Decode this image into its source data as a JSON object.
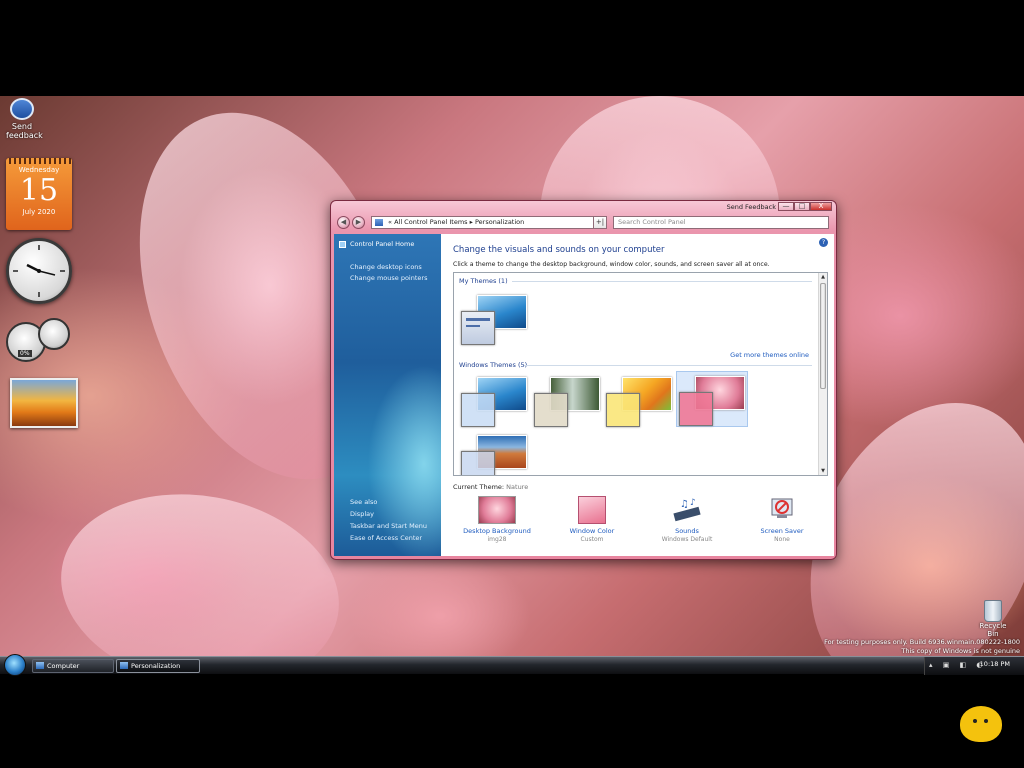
{
  "desktop": {
    "icon_label": "Send feedback",
    "calendar": {
      "weekday": "Wednesday",
      "day": "15",
      "month_year": "July 2020"
    },
    "gauge_label": "0%",
    "recycle_label": "Recycle Bin",
    "watermark": {
      "line1": "For testing purposes only. Build 6936.winmain.080222-1800",
      "line2": "This copy of Windows is not genuine"
    }
  },
  "window": {
    "send_feedback": "Send Feedback",
    "caption_buttons": {
      "minimize": "—",
      "maximize": "□",
      "close": "X"
    },
    "nav": {
      "back": "◀",
      "forward": "▶",
      "refresh": "+|"
    },
    "address": {
      "chevron": "«",
      "crumb1": "All Control Panel Items",
      "sep": "▸",
      "crumb2": "Personalization"
    },
    "search_placeholder": "Search Control Panel",
    "left_pane": {
      "home": "Control Panel Home",
      "links": [
        "Change desktop icons",
        "Change mouse pointers"
      ],
      "see_also": "See also",
      "see_also_links": [
        "Display",
        "Taskbar and Start Menu",
        "Ease of Access Center"
      ]
    },
    "content": {
      "help": "?",
      "title": "Change the visuals and sounds on your computer",
      "subtitle": "Click a theme to change the desktop background, window color, sounds, and screen saver all at once.",
      "my_themes_label": "My Themes (1)",
      "get_more": "Get more themes online",
      "windows_themes_label": "Windows Themes (5)",
      "current_theme_label": "Current Theme:",
      "current_theme_value": "Nature",
      "options": [
        {
          "label": "Desktop Background",
          "value": "img28"
        },
        {
          "label": "Window Color",
          "value": "Custom"
        },
        {
          "label": "Sounds",
          "value": "Windows Default"
        },
        {
          "label": "Screen Saver",
          "value": "None"
        }
      ]
    }
  },
  "taskbar": {
    "buttons": [
      "Computer",
      "Personalization"
    ],
    "active_button": "Personalization",
    "clock": "10:18 PM"
  },
  "colors": {
    "window_frame": "#e8859f",
    "link_blue": "#1e5bbf",
    "title_blue": "#1e3f8f",
    "left_pane_blue": "#1f5e9c"
  }
}
